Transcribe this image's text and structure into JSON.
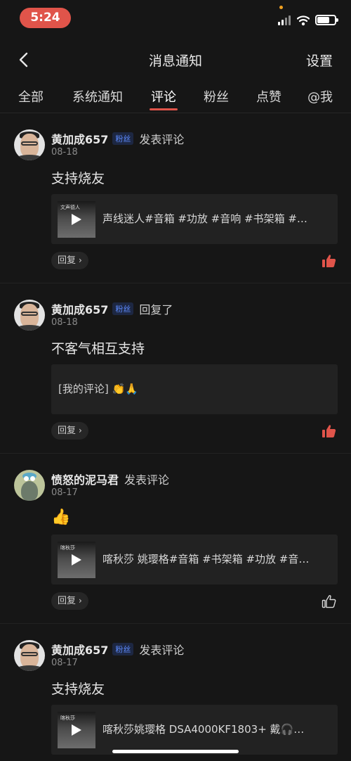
{
  "status_bar": {
    "time": "5:24",
    "battery_fraction": 0.7
  },
  "header": {
    "title": "消息通知",
    "settings_label": "设置"
  },
  "tabs": [
    {
      "label": "全部"
    },
    {
      "label": "系统通知"
    },
    {
      "label": "评论",
      "active": true
    },
    {
      "label": "粉丝"
    },
    {
      "label": "点赞"
    },
    {
      "label": "@我"
    }
  ],
  "notifications": [
    {
      "username": "黄加成657",
      "badge": "粉丝",
      "action": "发表评论",
      "date": "08-18",
      "comment": "支持烧友",
      "card_thumb_text": "文声德人",
      "card_title": "声线迷人#音箱 #功放 #音响 #书架箱 #…",
      "reply_label": "回复",
      "liked": true
    },
    {
      "username": "黄加成657",
      "badge": "粉丝",
      "action": "回复了",
      "date": "08-18",
      "comment": "不客气相互支持",
      "card_quote": "[我的评论] 👏🙏",
      "reply_label": "回复",
      "liked": true
    },
    {
      "username": "愤怒的泥马君",
      "action": "发表评论",
      "date": "08-17",
      "comment": "👍",
      "card_thumb_text": "喀秋莎",
      "card_title": "喀秋莎 姚璎格#音箱 #书架箱 #功放 #音…",
      "reply_label": "回复",
      "liked": false
    },
    {
      "username": "黄加成657",
      "badge": "粉丝",
      "action": "发表评论",
      "date": "08-17",
      "comment": "支持烧友",
      "card_thumb_text": "喀秋莎",
      "card_title": "喀秋莎姚璎格 DSA4000KF1803+ 戴🎧…",
      "reply_label": "回复",
      "liked": false
    }
  ],
  "colors": {
    "accent": "#e0544a",
    "badge_text": "#5d8bff",
    "background": "#161616"
  }
}
